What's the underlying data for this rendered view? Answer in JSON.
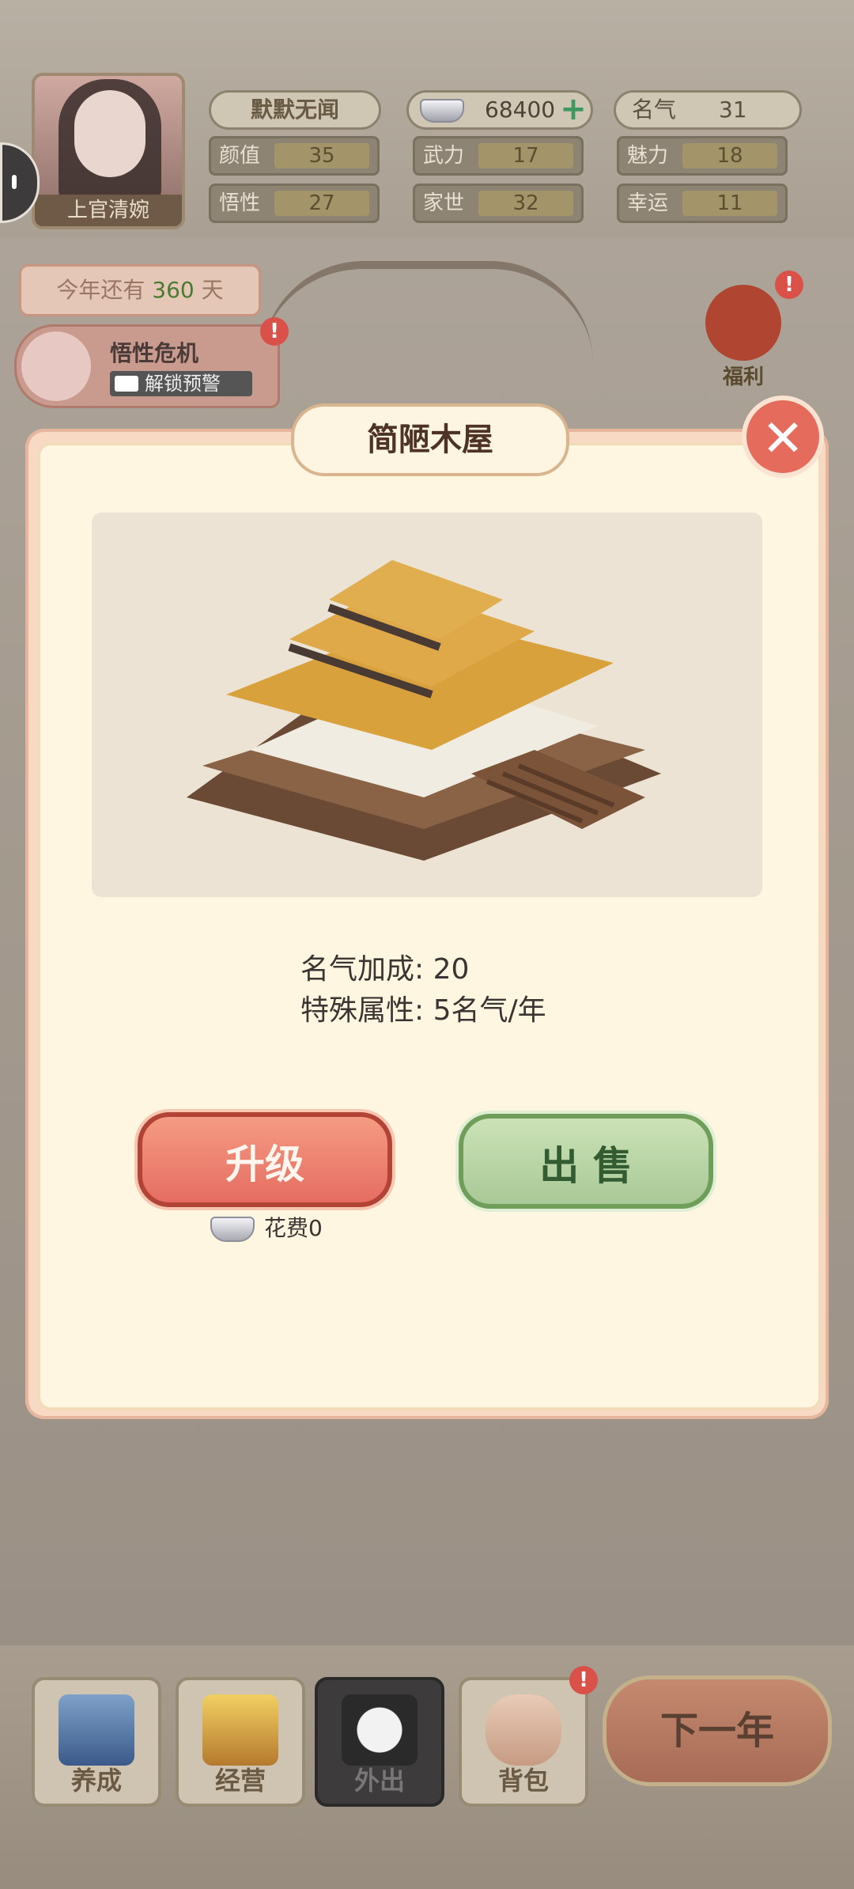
{
  "header": {
    "character_name": "上官清婉",
    "player_title": "默默无闻",
    "silver": "68400",
    "fame_label": "名气",
    "fame_value": "31",
    "stats": [
      {
        "label": "颜值",
        "value": "35"
      },
      {
        "label": "武力",
        "value": "17"
      },
      {
        "label": "魅力",
        "value": "18"
      },
      {
        "label": "悟性",
        "value": "27"
      },
      {
        "label": "家世",
        "value": "32"
      },
      {
        "label": "幸运",
        "value": "11"
      }
    ]
  },
  "days": {
    "prefix": "今年还有",
    "count": "360",
    "suffix": "天"
  },
  "crisis": {
    "title": "悟性危机",
    "action": "解锁预警"
  },
  "welfare": {
    "label": "福利",
    "badge": "!"
  },
  "dialog": {
    "title": "简陋木屋",
    "fame_bonus": "名气加成: 20",
    "special": "特殊属性: 5名气/年",
    "upgrade_label": "升级",
    "sell_label": "出 售",
    "cost_label": "花费0"
  },
  "bottom_nav": {
    "items": [
      {
        "label": "养成"
      },
      {
        "label": "经营"
      },
      {
        "label": "外出"
      },
      {
        "label": "背包"
      }
    ],
    "next_year": "下一年",
    "bag_badge": "!"
  },
  "colors": {
    "accent_red": "#e56d61",
    "accent_green": "#a9c996",
    "panel": "#fff6e1"
  }
}
